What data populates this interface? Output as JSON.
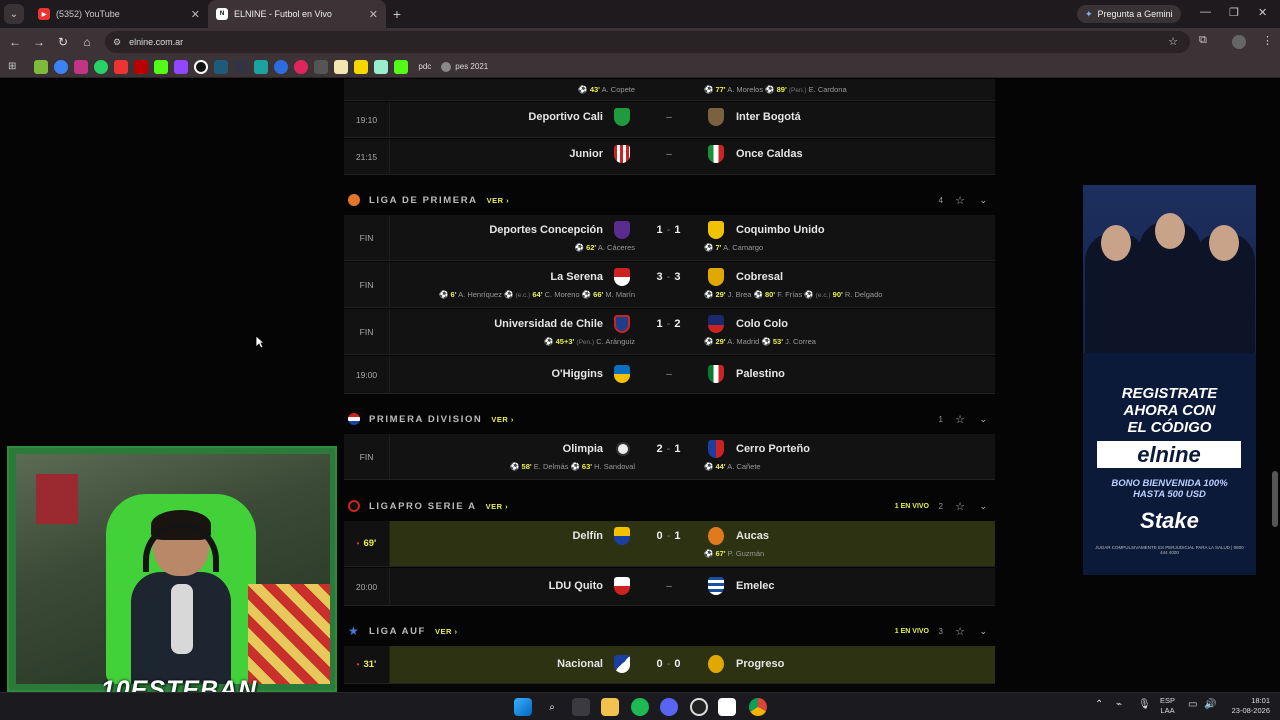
{
  "browser": {
    "tabs": [
      {
        "title": "(5352) YouTube",
        "close": "✕"
      },
      {
        "title": "ELNINE - Futbol en Vivo",
        "close": "✕"
      }
    ],
    "new_tab": "+",
    "gemini_button": "Pregunta a Gemini",
    "url": "elnine.com.ar",
    "bookmark_label_1": "pdc",
    "bookmark_label_2": "pes 2021"
  },
  "partial_row": {
    "home_goal_time": "43'",
    "home_goal_player": "A. Copete",
    "away_goal1_time": "77'",
    "away_goal1_player": "A. Morelos",
    "away_goal2_time": "89'",
    "away_goal2_pen": "(Pen.)",
    "away_goal2_player": "E. Cardona"
  },
  "colombia": [
    {
      "time": "19:10",
      "home": "Deportivo Cali",
      "away": "Inter Bogotá",
      "dash": "–"
    },
    {
      "time": "21:15",
      "home": "Junior",
      "away": "Once Caldas",
      "dash": "–"
    }
  ],
  "chile_league": {
    "name": "LIGA DE PRIMERA",
    "ver": "VER ›",
    "count": "4"
  },
  "chile": [
    {
      "time": "FIN",
      "home": "Deportes Concepción",
      "hs": "1",
      "as": "1",
      "away": "Coquimbo Unido",
      "hg": [
        {
          "t": "62'",
          "p": "A. Cáceres"
        }
      ],
      "ag": [
        {
          "t": "7'",
          "p": "A. Camargo"
        }
      ]
    },
    {
      "time": "FIN",
      "home": "La Serena",
      "hs": "3",
      "as": "3",
      "away": "Cobresal",
      "hg_text": {
        "g1t": "6'",
        "g1p": "A. Henríquez",
        "g2t": "64'",
        "g2e": "(e.c.)",
        "g2p": "C. Moreno",
        "g3t": "66'",
        "g3p": "M. Marín"
      },
      "ag_text": {
        "g1t": "29'",
        "g1p": "J. Brea",
        "g2t": "80'",
        "g2p": "F. Frías",
        "g3e": "(e.c.)",
        "g3t": "90'",
        "g3p": "R. Delgado"
      }
    },
    {
      "time": "FIN",
      "home": "Universidad de Chile",
      "hs": "1",
      "as": "2",
      "away": "Colo Colo",
      "hg_text": {
        "t": "45+3'",
        "pen": "(Pen.)",
        "p": "C. Aránguiz"
      },
      "ag_text": {
        "g1t": "29'",
        "g1p": "A. Madrid",
        "g2t": "53'",
        "g2p": "J. Correa"
      }
    },
    {
      "time": "19:00",
      "home": "O'Higgins",
      "away": "Palestino",
      "dash": "–"
    }
  ],
  "paraguay_league": {
    "name": "PRIMERA DIVISION",
    "ver": "VER ›",
    "count": "1"
  },
  "paraguay": {
    "time": "FIN",
    "home": "Olimpia",
    "hs": "2",
    "as": "1",
    "away": "Cerro Porteño",
    "hg_text": {
      "g1t": "58'",
      "g1p": "E. Delmás",
      "g2t": "63'",
      "g2p": "H. Sandoval"
    },
    "ag_text": {
      "t": "44'",
      "p": "A. Cañete"
    }
  },
  "ecuador_league": {
    "name": "LIGAPRO SERIE A",
    "ver": "VER ›",
    "live": "1 EN VIVO",
    "count": "2"
  },
  "ecuador": [
    {
      "time": "69'",
      "home": "Delfín",
      "hs": "0",
      "as": "1",
      "away": "Aucas",
      "ag_t": "67'",
      "ag_p": "P. Guzmán"
    },
    {
      "time": "20:00",
      "home": "LDU Quito",
      "away": "Emelec",
      "dash": "–"
    }
  ],
  "uruguay_league": {
    "name": "LIGA AUF",
    "ver": "VER ›",
    "live": "1 EN VIVO",
    "count": "3"
  },
  "uruguay": {
    "time": "31'",
    "home": "Nacional",
    "hs": "0",
    "as": "0",
    "away": "Progreso"
  },
  "ad": {
    "line1": "REGISTRATE",
    "line2": "AHORA CON",
    "line3": "EL CÓDIGO",
    "code": "elnine",
    "bonus1": "BONO BIENVENIDA 100%",
    "bonus2": "HASTA 500 USD",
    "brand": "Stake",
    "legal": "JUGAR COMPULSIVAMENTE ES PERJUDICIAL PARA LA SALUD | 0800 444 4000"
  },
  "webcam": {
    "name": "10ESTEBAN"
  },
  "taskbar": {
    "lang1": "ESP",
    "lang2": "LAA",
    "time": "18:01",
    "date": "23-08-2026"
  },
  "colors": {
    "accent": "#e8f04a",
    "live_bg": "#2c3212",
    "row_bg": "#121212"
  }
}
